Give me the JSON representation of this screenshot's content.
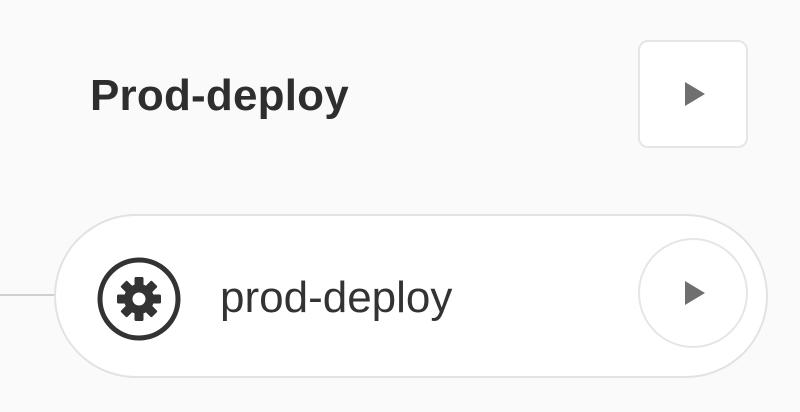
{
  "stage": {
    "title": "Prod-deploy",
    "run_icon": "play-icon"
  },
  "job": {
    "name": "prod-deploy",
    "status_icon": "gear-icon",
    "run_icon": "play-icon"
  },
  "colors": {
    "background": "#fafafa",
    "text_primary": "#2e2e2e",
    "icon": "#333333",
    "play": "#6f6f6f",
    "border": "#e2e2e2"
  }
}
